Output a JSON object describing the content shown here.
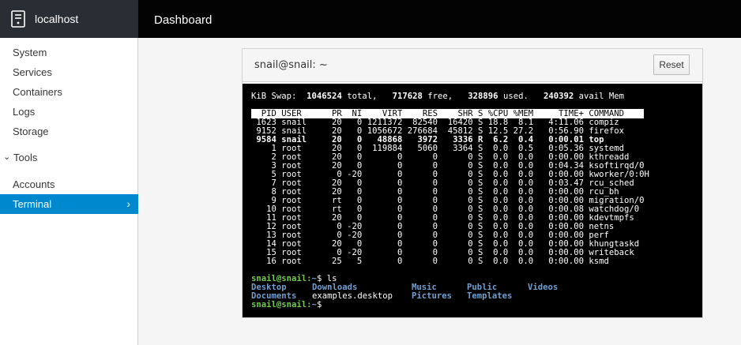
{
  "header": {
    "host": "localhost",
    "page_title": "Dashboard",
    "icon": "server-icon"
  },
  "sidebar": {
    "items": [
      {
        "label": "System"
      },
      {
        "label": "Services"
      },
      {
        "label": "Containers"
      },
      {
        "label": "Logs"
      },
      {
        "label": "Storage"
      }
    ],
    "tools_label": "Tools",
    "tools_items": [
      {
        "label": "Accounts"
      },
      {
        "label": "Terminal",
        "active": true
      }
    ],
    "chevron": "›",
    "caret": "⌄"
  },
  "terminal_panel": {
    "title": "snail@snail: ~",
    "reset_label": "Reset"
  },
  "terminal": {
    "swap_line": "KiB Swap:  1046524 total,   717628 free,   328896 used.   240392 avail Mem",
    "header_line": "  PID USER      PR  NI    VIRT    RES    SHR S %CPU %MEM     TIME+ COMMAND    ",
    "processes": [
      " 1623 snail     20   0 1211372  82540  16420 S 18.8  8.1   4:11.06 compiz",
      " 9152 snail     20   0 1056672 276684  45812 S 12.5 27.2   0:56.90 firefox",
      " 9584 snail     20   0   48868   3972   3336 R  6.2  0.4   0:00.01 top",
      "    1 root      20   0  119884   5060   3364 S  0.0  0.5   0:05.36 systemd",
      "    2 root      20   0       0      0      0 S  0.0  0.0   0:00.00 kthreadd",
      "    3 root      20   0       0      0      0 S  0.0  0.0   0:04.34 ksoftirqd/0",
      "    5 root       0 -20       0      0      0 S  0.0  0.0   0:00.00 kworker/0:0H",
      "    7 root      20   0       0      0      0 S  0.0  0.0   0:03.47 rcu_sched",
      "    8 root      20   0       0      0      0 S  0.0  0.0   0:00.00 rcu_bh",
      "    9 root      rt   0       0      0      0 S  0.0  0.0   0:00.00 migration/0",
      "   10 root      rt   0       0      0      0 S  0.0  0.0   0:00.08 watchdog/0",
      "   11 root      20   0       0      0      0 S  0.0  0.0   0:00.00 kdevtmpfs",
      "   12 root       0 -20       0      0      0 S  0.0  0.0   0:00.00 netns",
      "   13 root       0 -20       0      0      0 S  0.0  0.0   0:00.00 perf",
      "   14 root      20   0       0      0      0 S  0.0  0.0   0:00.00 khungtaskd",
      "   15 root       0 -20       0      0      0 S  0.0  0.0   0:00.00 writeback",
      "   16 root      25   5       0      0      0 S  0.0  0.0   0:00.00 ksmd"
    ],
    "prompt": "snail@snail:",
    "path": "~",
    "cmd1": "$ ls",
    "ls_row1": [
      {
        "text": "Desktop",
        "dir": true
      },
      {
        "text": "Downloads",
        "dir": true
      },
      {
        "text": "Music",
        "dir": true
      },
      {
        "text": "Public",
        "dir": true
      },
      {
        "text": "Videos",
        "dir": true
      }
    ],
    "ls_row2": [
      {
        "text": "Documents",
        "dir": true
      },
      {
        "text": "examples.desktop",
        "dir": false
      },
      {
        "text": "Pictures",
        "dir": true
      },
      {
        "text": "Templates",
        "dir": true
      }
    ],
    "cmd2": "$"
  },
  "colors": {
    "accent": "#0088ce",
    "prompt_green": "#75c954",
    "dir_blue": "#729fcf"
  }
}
